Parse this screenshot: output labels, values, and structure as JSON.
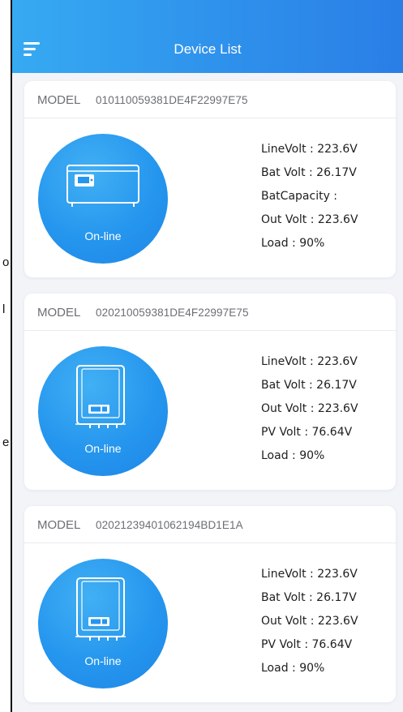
{
  "edge_chars": [
    "o",
    "l",
    "e"
  ],
  "header": {
    "title": "Device List",
    "menu_icon": "menu-icon"
  },
  "colors": {
    "header_start": "#36aaf2",
    "header_end": "#2a7ee6",
    "circle": "#2596ee",
    "page_bg": "#f2f4f8"
  },
  "devices": [
    {
      "model_label": "MODEL",
      "model_id": "010110059381DE4F22997E75",
      "status": "On-line",
      "icon": "inverter-horizontal-icon",
      "readings": [
        "LineVolt : 223.6V",
        "Bat Volt : 26.17V",
        "BatCapacity :",
        "Out Volt : 223.6V",
        "Load : 90%"
      ]
    },
    {
      "model_label": "MODEL",
      "model_id": "020210059381DE4F22997E75",
      "status": "On-line",
      "icon": "inverter-vertical-icon",
      "readings": [
        "LineVolt : 223.6V",
        "Bat Volt : 26.17V",
        "Out Volt : 223.6V",
        "PV Volt : 76.64V",
        "Load : 90%"
      ]
    },
    {
      "model_label": "MODEL",
      "model_id": "02021239401062194BD1E1A",
      "status": "On-line",
      "icon": "inverter-vertical-icon",
      "readings": [
        "LineVolt : 223.6V",
        "Bat Volt : 26.17V",
        "Out Volt : 223.6V",
        "PV Volt : 76.64V",
        "Load : 90%"
      ]
    }
  ]
}
